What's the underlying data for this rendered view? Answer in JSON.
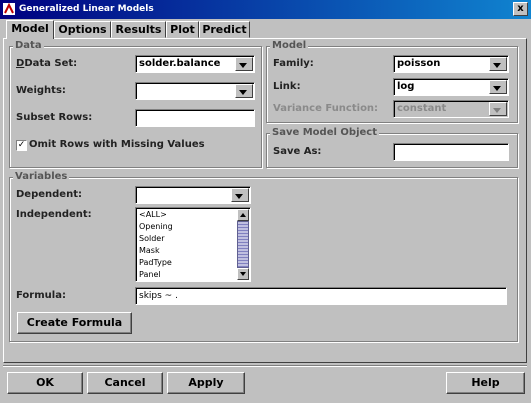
{
  "window": {
    "title": "Generalized Linear Models",
    "close_glyph": "x"
  },
  "tabs": [
    {
      "label": "Model",
      "active": true
    },
    {
      "label": "Options",
      "active": false
    },
    {
      "label": "Results",
      "active": false
    },
    {
      "label": "Plot",
      "active": false
    },
    {
      "label": "Predict",
      "active": false
    }
  ],
  "data_group": {
    "title": "Data",
    "data_set_label": "Data Set:",
    "data_set_value": "solder.balance",
    "weights_label": "Weights:",
    "weights_value": "",
    "subset_rows_label": "Subset Rows:",
    "subset_rows_value": "",
    "omit_rows_label": "Omit Rows with Missing Values",
    "omit_rows_checked": true,
    "omit_rows_mark": "✓"
  },
  "model_group": {
    "title": "Model",
    "family_label": "Family:",
    "family_value": "poisson",
    "link_label": "Link:",
    "link_value": "log",
    "variance_label": "Variance Function:",
    "variance_value": "constant"
  },
  "save_group": {
    "title": "Save Model Object",
    "save_as_label": "Save As:",
    "save_as_value": ""
  },
  "variables_group": {
    "title": "Variables",
    "dependent_label": "Dependent:",
    "dependent_value": "",
    "independent_label": "Independent:",
    "independent_items": [
      "<ALL>",
      "Opening",
      "Solder",
      "Mask",
      "PadType",
      "Panel"
    ],
    "formula_label": "Formula:",
    "formula_value": "skips ~ .",
    "create_formula_label": "Create Formula"
  },
  "footer": {
    "ok_label": "OK",
    "cancel_label": "Cancel",
    "apply_label": "Apply",
    "help_label": "Help"
  },
  "colors": {
    "title_bar": "#000080",
    "face": "#c0c0c0"
  }
}
